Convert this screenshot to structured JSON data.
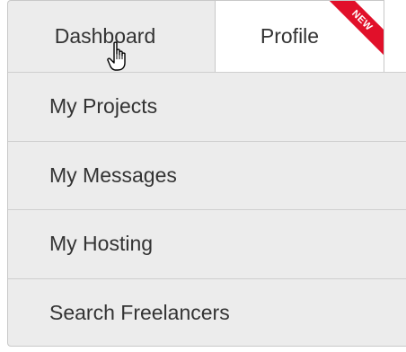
{
  "tabs": [
    {
      "label": "Dashboard",
      "active": true
    },
    {
      "label": "Profile",
      "badge": "NEW"
    }
  ],
  "menu": {
    "items": [
      {
        "label": "My Projects"
      },
      {
        "label": "My Messages"
      },
      {
        "label": "My Hosting"
      },
      {
        "label": "Search Freelancers"
      }
    ]
  },
  "cursor": {
    "icon": "hand-pointer-icon"
  },
  "colors": {
    "menu_background": "#ececec",
    "border": "#c8c8c8",
    "text": "#333333",
    "badge_red": "#e1102a"
  }
}
